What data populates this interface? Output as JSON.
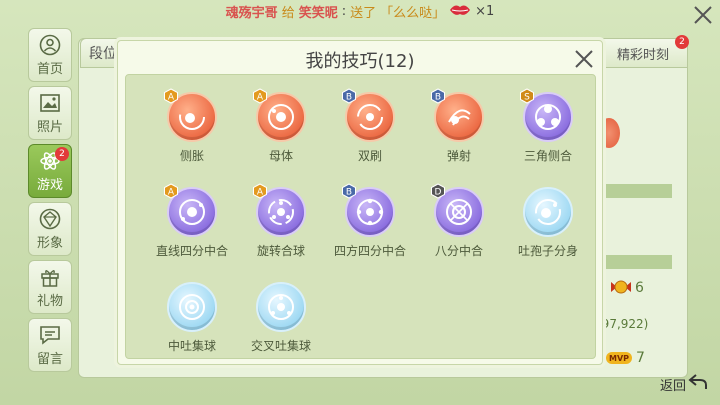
{
  "banner": {
    "sender": "魂殇宇哥",
    "verb": "给",
    "receiver": "笑笑昵",
    "colon": ":",
    "action": "送了",
    "gift": "「么么哒」",
    "count": "×1"
  },
  "sidebar": {
    "items": [
      {
        "label": "首页",
        "icon": "user-circle-icon",
        "active": false
      },
      {
        "label": "照片",
        "icon": "photo-icon",
        "active": false
      },
      {
        "label": "游戏",
        "icon": "atom-icon",
        "active": true,
        "badge": "2"
      },
      {
        "label": "形象",
        "icon": "gem-icon",
        "active": false
      },
      {
        "label": "礼物",
        "icon": "gift-icon",
        "active": false
      },
      {
        "label": "留言",
        "icon": "message-icon",
        "active": false
      }
    ]
  },
  "background": {
    "tab_left": "段位",
    "tab_right": "精彩时刻",
    "tab_right_badge": "2",
    "text_a": "6",
    "text_b": "(97,922)",
    "mvp_label": "MVP",
    "text_c": "7"
  },
  "modal": {
    "title": "我的技巧(12)"
  },
  "skills": [
    {
      "name": "侧胀",
      "grade": "A",
      "color": "red"
    },
    {
      "name": "母体",
      "grade": "A",
      "color": "red"
    },
    {
      "name": "双刷",
      "grade": "B",
      "color": "red"
    },
    {
      "name": "弹射",
      "grade": "B",
      "color": "red"
    },
    {
      "name": "三角侧合",
      "grade": "S",
      "color": "purple"
    },
    {
      "name": "直线四分中合",
      "grade": "A",
      "color": "purple"
    },
    {
      "name": "旋转合球",
      "grade": "A",
      "color": "purple"
    },
    {
      "name": "四方四分中合",
      "grade": "B",
      "color": "purple"
    },
    {
      "name": "八分中合",
      "grade": "D",
      "color": "purple"
    },
    {
      "name": "吐孢子分身",
      "grade": "",
      "color": "blue"
    },
    {
      "name": "中吐集球",
      "grade": "",
      "color": "blue"
    },
    {
      "name": "交叉吐集球",
      "grade": "",
      "color": "blue"
    }
  ],
  "footer": {
    "back_label": "返回"
  },
  "colors": {
    "grade_A": "#e39a1f",
    "grade_B": "#4a6aa8",
    "grade_S": "#d08a18",
    "grade_D": "#555555"
  }
}
